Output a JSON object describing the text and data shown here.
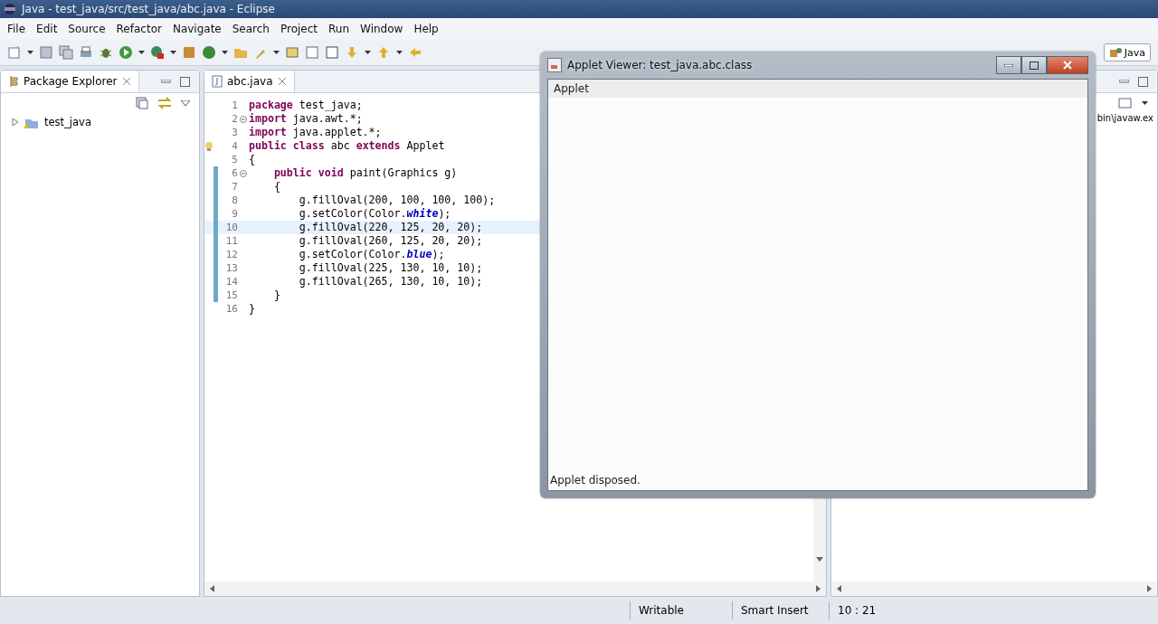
{
  "window": {
    "title": "Java - test_java/src/test_java/abc.java - Eclipse"
  },
  "menu": [
    "File",
    "Edit",
    "Source",
    "Refactor",
    "Navigate",
    "Search",
    "Project",
    "Run",
    "Window",
    "Help"
  ],
  "perspective": {
    "label": "Java",
    "selected": true
  },
  "package_explorer": {
    "title": "Package Explorer",
    "items": [
      {
        "label": "test_java",
        "expanded": false
      }
    ]
  },
  "editor": {
    "tabs": [
      {
        "label": "abc.java",
        "selected": true
      }
    ],
    "lines": [
      {
        "number": "1",
        "fold": false,
        "warning": false,
        "changed": false,
        "current": false,
        "tokens": [
          {
            "kind": "keyword",
            "text": "package"
          },
          {
            "kind": "plain",
            "text": " test_java;"
          }
        ]
      },
      {
        "number": "2",
        "fold": true,
        "warning": false,
        "changed": false,
        "current": false,
        "tokens": [
          {
            "kind": "keyword",
            "text": "import"
          },
          {
            "kind": "plain",
            "text": " java.awt.*;"
          }
        ]
      },
      {
        "number": "3",
        "fold": false,
        "warning": false,
        "changed": false,
        "current": false,
        "tokens": [
          {
            "kind": "keyword",
            "text": "import"
          },
          {
            "kind": "plain",
            "text": " java.applet.*;"
          }
        ]
      },
      {
        "number": "4",
        "fold": false,
        "warning": true,
        "changed": false,
        "current": false,
        "tokens": [
          {
            "kind": "keyword",
            "text": "public"
          },
          {
            "kind": "keyword",
            "text": " class"
          },
          {
            "kind": "plain",
            "text": " abc "
          },
          {
            "kind": "keyword",
            "text": "extends"
          },
          {
            "kind": "plain",
            "text": " Applet"
          }
        ]
      },
      {
        "number": "5",
        "fold": false,
        "warning": false,
        "changed": false,
        "current": false,
        "tokens": [
          {
            "kind": "plain",
            "text": "{"
          }
        ]
      },
      {
        "number": "6",
        "fold": true,
        "warning": false,
        "changed": true,
        "current": false,
        "tokens": [
          {
            "kind": "keyword",
            "text": "    public"
          },
          {
            "kind": "keyword",
            "text": " void"
          },
          {
            "kind": "plain",
            "text": " paint(Graphics g)"
          }
        ]
      },
      {
        "number": "7",
        "fold": false,
        "warning": false,
        "changed": true,
        "current": false,
        "tokens": [
          {
            "kind": "plain",
            "text": "    {"
          }
        ]
      },
      {
        "number": "8",
        "fold": false,
        "warning": false,
        "changed": true,
        "current": false,
        "tokens": [
          {
            "kind": "plain",
            "text": "        g.fillOval(200, 100, 100, 100);"
          }
        ]
      },
      {
        "number": "9",
        "fold": false,
        "warning": false,
        "changed": true,
        "current": false,
        "tokens": [
          {
            "kind": "plain",
            "text": "        g.setColor(Color."
          },
          {
            "kind": "field",
            "text": "white"
          },
          {
            "kind": "plain",
            "text": ");"
          }
        ]
      },
      {
        "number": "10",
        "fold": false,
        "warning": false,
        "changed": true,
        "current": true,
        "tokens": [
          {
            "kind": "plain",
            "text": "        g.fillOval(220, 125, 20, 20);"
          }
        ]
      },
      {
        "number": "11",
        "fold": false,
        "warning": false,
        "changed": true,
        "current": false,
        "tokens": [
          {
            "kind": "plain",
            "text": "        g.fillOval(260, 125, 20, 20);"
          }
        ]
      },
      {
        "number": "12",
        "fold": false,
        "warning": false,
        "changed": true,
        "current": false,
        "tokens": [
          {
            "kind": "plain",
            "text": "        g.setColor(Color."
          },
          {
            "kind": "field",
            "text": "blue"
          },
          {
            "kind": "plain",
            "text": ");"
          }
        ]
      },
      {
        "number": "13",
        "fold": false,
        "warning": false,
        "changed": true,
        "current": false,
        "tokens": [
          {
            "kind": "plain",
            "text": "        g.fillOval(225, 130, 10, 10);"
          }
        ]
      },
      {
        "number": "14",
        "fold": false,
        "warning": false,
        "changed": true,
        "current": false,
        "tokens": [
          {
            "kind": "plain",
            "text": "        g.fillOval(265, 130, 10, 10);"
          }
        ]
      },
      {
        "number": "15",
        "fold": false,
        "warning": false,
        "changed": true,
        "current": false,
        "tokens": [
          {
            "kind": "plain",
            "text": "    }"
          }
        ]
      },
      {
        "number": "16",
        "fold": false,
        "warning": false,
        "changed": false,
        "current": false,
        "tokens": [
          {
            "kind": "plain",
            "text": "}"
          }
        ]
      }
    ]
  },
  "console": {
    "path": "bin\\javaw.ex"
  },
  "applet_viewer": {
    "title": "Applet Viewer: test_java.abc.class",
    "menu": "Applet",
    "status": "Applet disposed.",
    "close_hovered": true
  },
  "status_bar": [
    "Writable",
    "Smart Insert",
    "10 : 21"
  ]
}
